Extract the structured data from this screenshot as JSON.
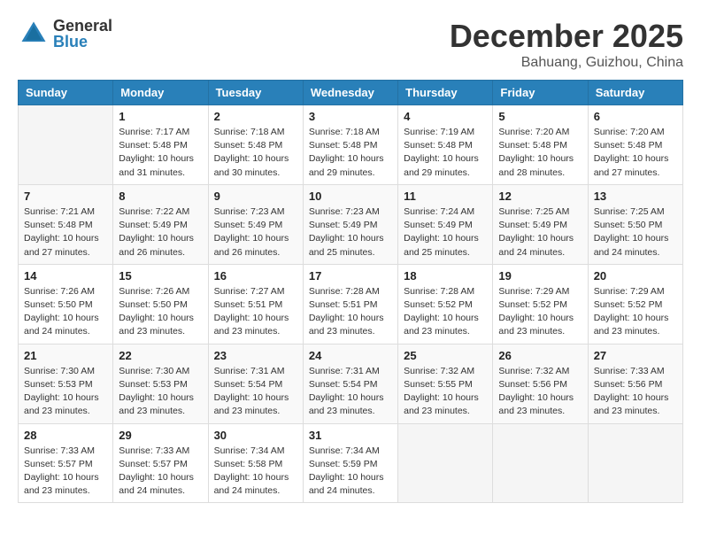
{
  "header": {
    "logo_general": "General",
    "logo_blue": "Blue",
    "month": "December 2025",
    "location": "Bahuang, Guizhou, China"
  },
  "weekdays": [
    "Sunday",
    "Monday",
    "Tuesday",
    "Wednesday",
    "Thursday",
    "Friday",
    "Saturday"
  ],
  "weeks": [
    [
      {
        "day": "",
        "info": ""
      },
      {
        "day": "1",
        "info": "Sunrise: 7:17 AM\nSunset: 5:48 PM\nDaylight: 10 hours\nand 31 minutes."
      },
      {
        "day": "2",
        "info": "Sunrise: 7:18 AM\nSunset: 5:48 PM\nDaylight: 10 hours\nand 30 minutes."
      },
      {
        "day": "3",
        "info": "Sunrise: 7:18 AM\nSunset: 5:48 PM\nDaylight: 10 hours\nand 29 minutes."
      },
      {
        "day": "4",
        "info": "Sunrise: 7:19 AM\nSunset: 5:48 PM\nDaylight: 10 hours\nand 29 minutes."
      },
      {
        "day": "5",
        "info": "Sunrise: 7:20 AM\nSunset: 5:48 PM\nDaylight: 10 hours\nand 28 minutes."
      },
      {
        "day": "6",
        "info": "Sunrise: 7:20 AM\nSunset: 5:48 PM\nDaylight: 10 hours\nand 27 minutes."
      }
    ],
    [
      {
        "day": "7",
        "info": "Sunrise: 7:21 AM\nSunset: 5:48 PM\nDaylight: 10 hours\nand 27 minutes."
      },
      {
        "day": "8",
        "info": "Sunrise: 7:22 AM\nSunset: 5:49 PM\nDaylight: 10 hours\nand 26 minutes."
      },
      {
        "day": "9",
        "info": "Sunrise: 7:23 AM\nSunset: 5:49 PM\nDaylight: 10 hours\nand 26 minutes."
      },
      {
        "day": "10",
        "info": "Sunrise: 7:23 AM\nSunset: 5:49 PM\nDaylight: 10 hours\nand 25 minutes."
      },
      {
        "day": "11",
        "info": "Sunrise: 7:24 AM\nSunset: 5:49 PM\nDaylight: 10 hours\nand 25 minutes."
      },
      {
        "day": "12",
        "info": "Sunrise: 7:25 AM\nSunset: 5:49 PM\nDaylight: 10 hours\nand 24 minutes."
      },
      {
        "day": "13",
        "info": "Sunrise: 7:25 AM\nSunset: 5:50 PM\nDaylight: 10 hours\nand 24 minutes."
      }
    ],
    [
      {
        "day": "14",
        "info": "Sunrise: 7:26 AM\nSunset: 5:50 PM\nDaylight: 10 hours\nand 24 minutes."
      },
      {
        "day": "15",
        "info": "Sunrise: 7:26 AM\nSunset: 5:50 PM\nDaylight: 10 hours\nand 23 minutes."
      },
      {
        "day": "16",
        "info": "Sunrise: 7:27 AM\nSunset: 5:51 PM\nDaylight: 10 hours\nand 23 minutes."
      },
      {
        "day": "17",
        "info": "Sunrise: 7:28 AM\nSunset: 5:51 PM\nDaylight: 10 hours\nand 23 minutes."
      },
      {
        "day": "18",
        "info": "Sunrise: 7:28 AM\nSunset: 5:52 PM\nDaylight: 10 hours\nand 23 minutes."
      },
      {
        "day": "19",
        "info": "Sunrise: 7:29 AM\nSunset: 5:52 PM\nDaylight: 10 hours\nand 23 minutes."
      },
      {
        "day": "20",
        "info": "Sunrise: 7:29 AM\nSunset: 5:52 PM\nDaylight: 10 hours\nand 23 minutes."
      }
    ],
    [
      {
        "day": "21",
        "info": "Sunrise: 7:30 AM\nSunset: 5:53 PM\nDaylight: 10 hours\nand 23 minutes."
      },
      {
        "day": "22",
        "info": "Sunrise: 7:30 AM\nSunset: 5:53 PM\nDaylight: 10 hours\nand 23 minutes."
      },
      {
        "day": "23",
        "info": "Sunrise: 7:31 AM\nSunset: 5:54 PM\nDaylight: 10 hours\nand 23 minutes."
      },
      {
        "day": "24",
        "info": "Sunrise: 7:31 AM\nSunset: 5:54 PM\nDaylight: 10 hours\nand 23 minutes."
      },
      {
        "day": "25",
        "info": "Sunrise: 7:32 AM\nSunset: 5:55 PM\nDaylight: 10 hours\nand 23 minutes."
      },
      {
        "day": "26",
        "info": "Sunrise: 7:32 AM\nSunset: 5:56 PM\nDaylight: 10 hours\nand 23 minutes."
      },
      {
        "day": "27",
        "info": "Sunrise: 7:33 AM\nSunset: 5:56 PM\nDaylight: 10 hours\nand 23 minutes."
      }
    ],
    [
      {
        "day": "28",
        "info": "Sunrise: 7:33 AM\nSunset: 5:57 PM\nDaylight: 10 hours\nand 23 minutes."
      },
      {
        "day": "29",
        "info": "Sunrise: 7:33 AM\nSunset: 5:57 PM\nDaylight: 10 hours\nand 24 minutes."
      },
      {
        "day": "30",
        "info": "Sunrise: 7:34 AM\nSunset: 5:58 PM\nDaylight: 10 hours\nand 24 minutes."
      },
      {
        "day": "31",
        "info": "Sunrise: 7:34 AM\nSunset: 5:59 PM\nDaylight: 10 hours\nand 24 minutes."
      },
      {
        "day": "",
        "info": ""
      },
      {
        "day": "",
        "info": ""
      },
      {
        "day": "",
        "info": ""
      }
    ]
  ]
}
